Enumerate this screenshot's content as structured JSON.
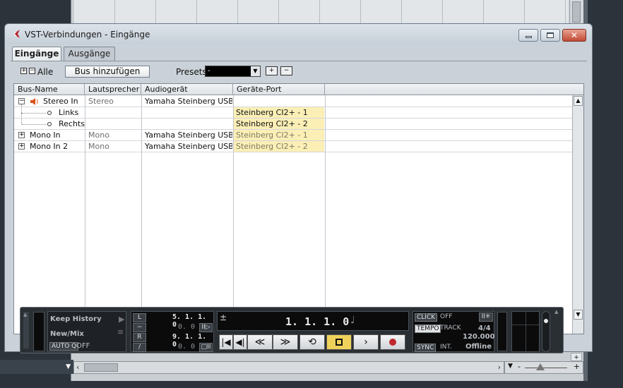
{
  "window": {
    "title": "VST-Verbindungen - Eingänge",
    "controls": {
      "minimize": "minimize-icon",
      "maximize": "maximize-icon",
      "close_glyph": "✕"
    }
  },
  "tabs": [
    {
      "label": "Eingänge",
      "active": true
    },
    {
      "label": "Ausgänge",
      "active": false
    }
  ],
  "toolbar": {
    "expand_glyph": "+",
    "collapse_glyph": "−",
    "all_label": "Alle",
    "add_bus_label": "Bus hinzufügen",
    "presets_label": "Presets",
    "presets_value": "-",
    "preset_store_icon": "store-preset-icon",
    "preset_remove_icon": "remove-preset-icon"
  },
  "table": {
    "columns": [
      "Bus-Name",
      "Lautsprecher",
      "Audiogerät",
      "Geräte-Port"
    ],
    "rows": [
      {
        "toggle": "−",
        "name": "Stereo In",
        "speaker": "Stereo",
        "device": "Yamaha Steinberg USB A",
        "port": ""
      },
      {
        "name": "Links",
        "speaker": "",
        "device": "",
        "port": "Steinberg CI2+ - 1"
      },
      {
        "name": "Rechts",
        "speaker": "",
        "device": "",
        "port": "Steinberg CI2+ - 2"
      },
      {
        "toggle": "+",
        "name": "Mono In",
        "speaker": "Mono",
        "device": "Yamaha Steinberg USB A",
        "port": "Steinberg CI2+ - 1"
      },
      {
        "toggle": "+",
        "name": "Mono In 2",
        "speaker": "Mono",
        "device": "Yamaha Steinberg USB A",
        "port": "Steinberg CI2+ - 2"
      }
    ]
  },
  "transport": {
    "history_label": "Keep History",
    "mode_label": "New/Mix",
    "autoq_label": "AUTO Q",
    "autoq_value": "OFF",
    "left_locator": "5. 1. 1.   0",
    "left_sub": "0.   0",
    "right_locator": "9. 1. 1.   0",
    "right_sub": "0.   0",
    "locator_l": "L",
    "locator_r": "R",
    "position": "1. 1. 1.   0",
    "plusminus": "±",
    "click_label": "CLICK",
    "click_value": "OFF",
    "tempo_label": "TEMPO",
    "tempo_mode": "TRACK",
    "signature": "4/4",
    "tempo_value": "120.000",
    "sync_label": "SYNC",
    "sync_source": "INT.",
    "sync_status": "Offline",
    "buttons": [
      "|◀",
      "◀|",
      "≪",
      "≫",
      "cycle",
      "stop",
      "play",
      "record"
    ],
    "accent_stop": "#f0d25a",
    "accent_record": "#c0282d"
  },
  "colors": {
    "port_highlight": "#fbefb6",
    "close_button": "#c14b34",
    "window_bg": "#cad1d8"
  }
}
